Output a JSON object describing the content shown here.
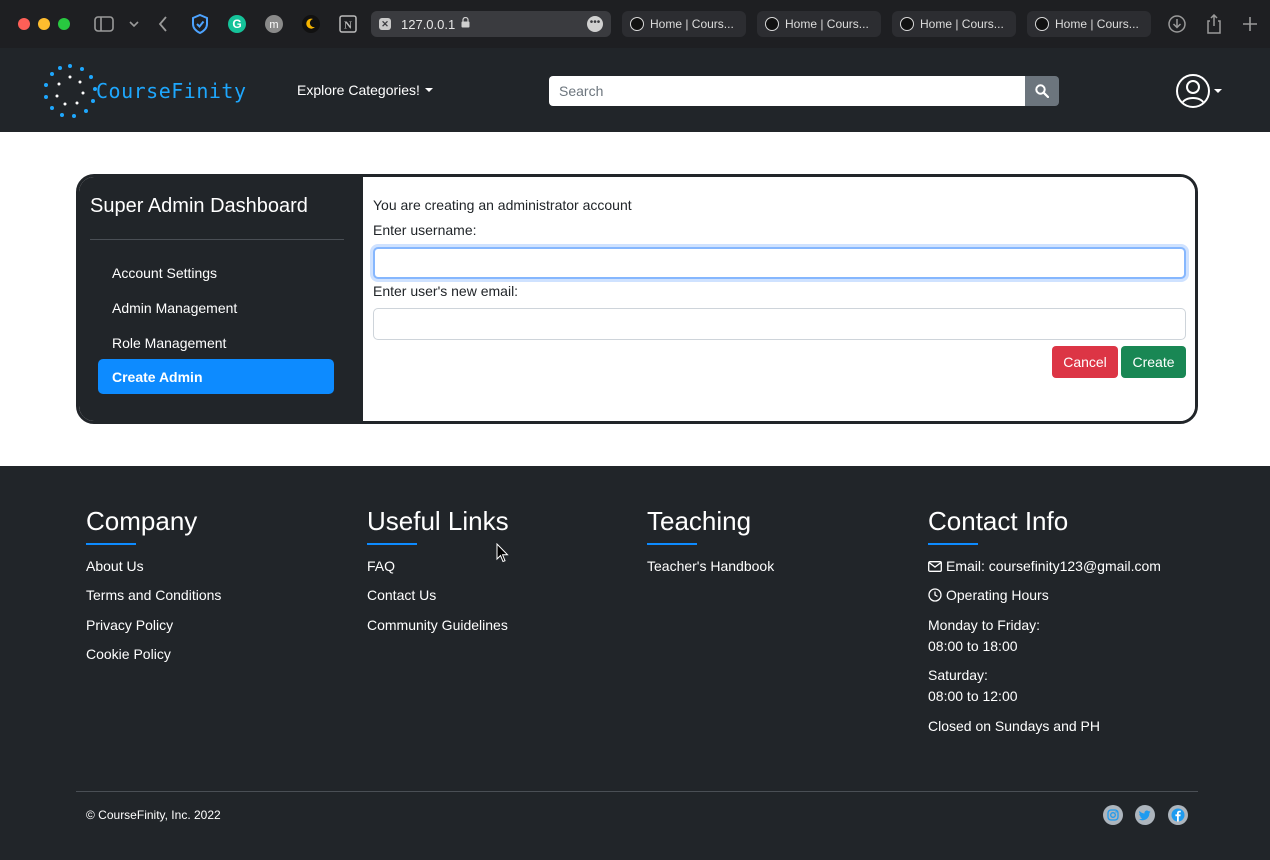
{
  "browser": {
    "url": "127.0.0.1",
    "tabs": [
      "Home | Cours...",
      "Home | Cours...",
      "Home | Cours...",
      "Home | Cours..."
    ]
  },
  "navbar": {
    "brand": "CourseFinity",
    "explore_label": "Explore Categories!",
    "search_placeholder": "Search"
  },
  "dashboard": {
    "title": "Super Admin Dashboard",
    "menu": [
      {
        "label": "Account Settings",
        "active": false
      },
      {
        "label": "Admin Management",
        "active": false
      },
      {
        "label": "Role Management",
        "active": false
      },
      {
        "label": "Create Admin",
        "active": true
      }
    ],
    "form": {
      "intro": "You are creating an administrator account",
      "username_label": "Enter username:",
      "username_value": "",
      "email_label": "Enter user's new email:",
      "email_value": "",
      "cancel_label": "Cancel",
      "create_label": "Create"
    }
  },
  "footer": {
    "company": {
      "heading": "Company",
      "links": [
        "About Us",
        "Terms and Conditions",
        "Privacy Policy",
        "Cookie Policy"
      ]
    },
    "useful": {
      "heading": "Useful Links",
      "links": [
        "FAQ",
        "Contact Us",
        "Community Guidelines"
      ]
    },
    "teaching": {
      "heading": "Teaching",
      "links": [
        "Teacher's Handbook"
      ]
    },
    "contact": {
      "heading": "Contact Info",
      "email": "Email: coursefinity123@gmail.com",
      "hours_label": "Operating Hours",
      "weekday_label": "Monday to Friday:",
      "weekday_hours": "08:00 to 18:00",
      "saturday_label": "Saturday:",
      "saturday_hours": "08:00 to 12:00",
      "closed": "Closed on Sundays and PH"
    },
    "copyright": "© CourseFinity, Inc. 2022",
    "social_icons": [
      "instagram-icon",
      "twitter-icon",
      "facebook-icon"
    ]
  },
  "colors": {
    "dark": "#212529",
    "accent": "#0d8bff",
    "cancel": "#dc3545",
    "create": "#198754"
  }
}
